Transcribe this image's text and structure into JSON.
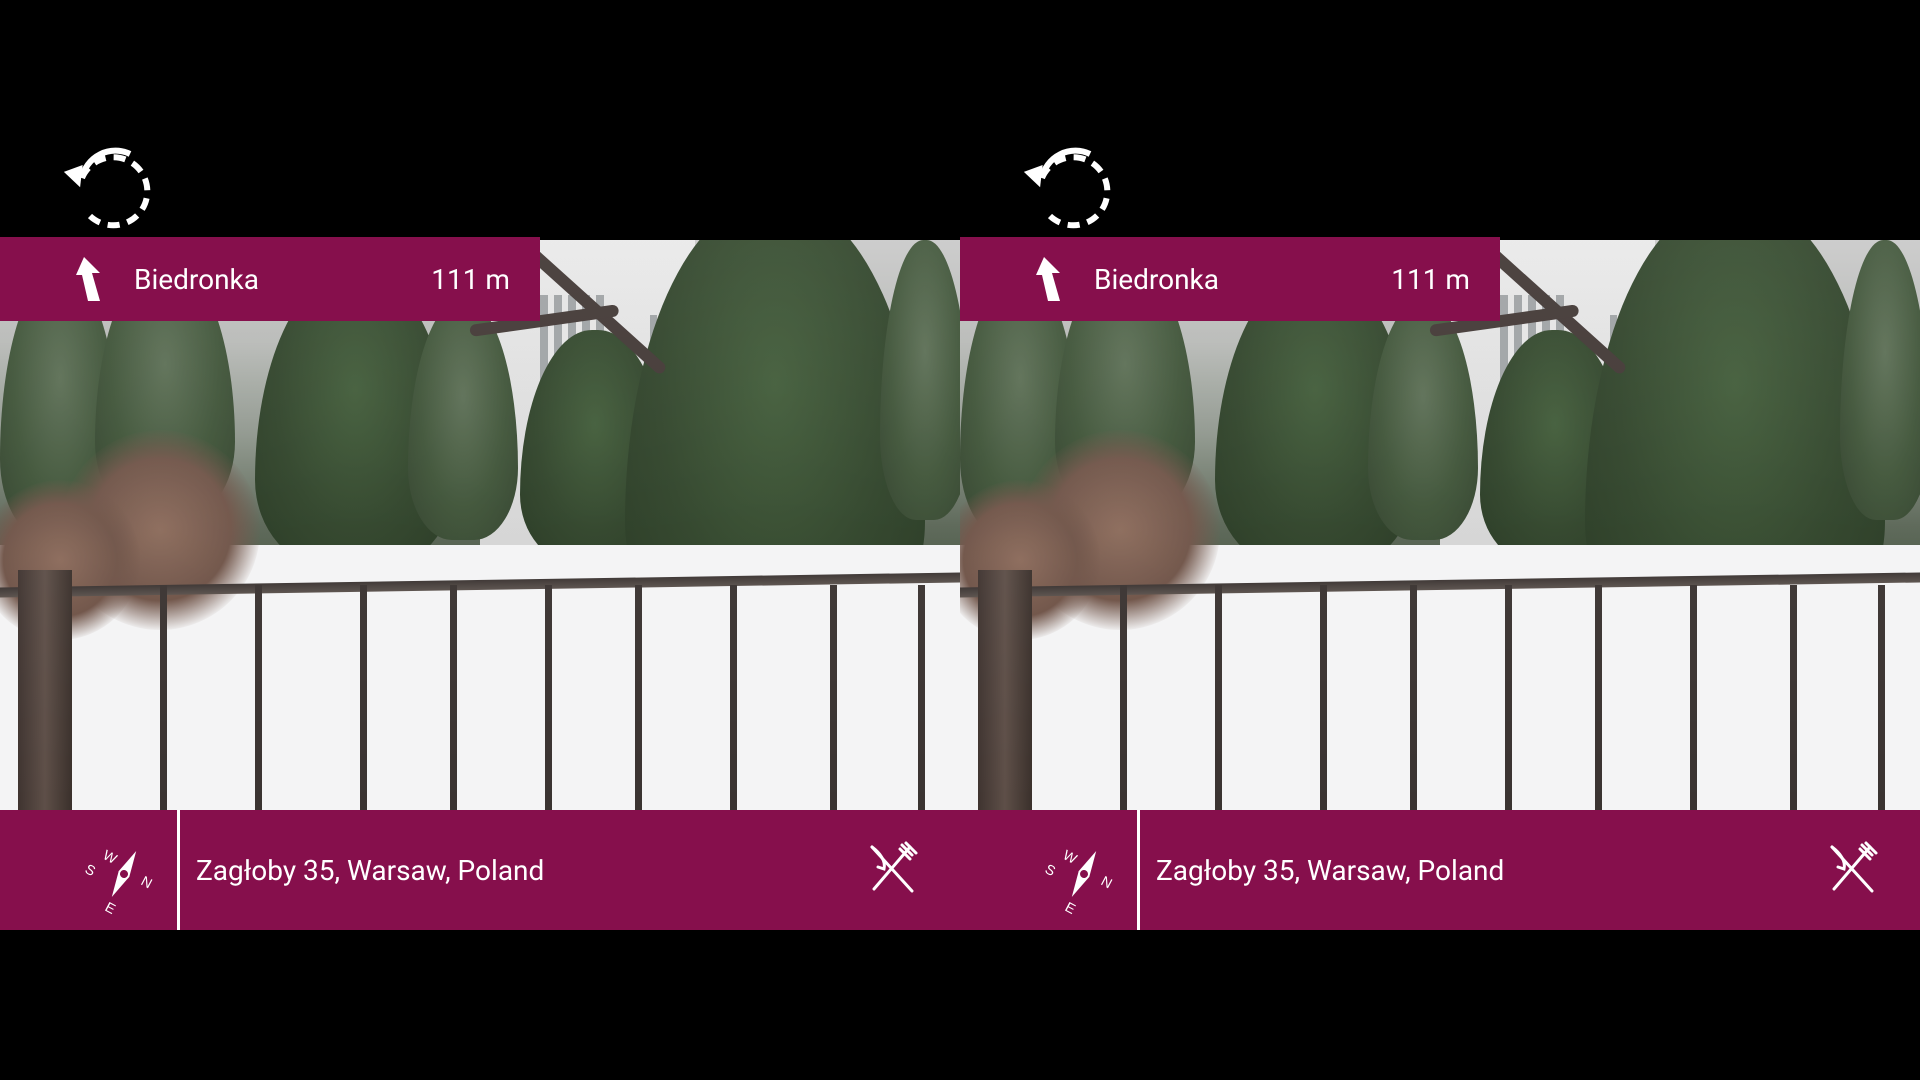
{
  "theme": {
    "accent": "#860f4c",
    "background": "#000000",
    "text": "#ffffff"
  },
  "left_eye": {
    "reset_icon": "rotate-ccw-icon",
    "destination": {
      "direction_icon": "arrow-up-left-icon",
      "name": "Biedronka",
      "distance": "111 m"
    },
    "status": {
      "compass_icon": "compass-icon",
      "compass_labels": [
        "W",
        "N",
        "S",
        "E"
      ],
      "address": "Zagłoby 35, Warsaw, Poland",
      "category_icon": "fork-knife-icon"
    }
  },
  "right_eye": {
    "reset_icon": "rotate-ccw-icon",
    "destination": {
      "direction_icon": "arrow-up-left-icon",
      "name": "Biedronka",
      "distance": "111 m"
    },
    "status": {
      "compass_icon": "compass-icon",
      "compass_labels": [
        "W",
        "N",
        "S",
        "E"
      ],
      "address": "Zagłoby 35, Warsaw, Poland",
      "category_icon": "fork-knife-icon"
    }
  }
}
